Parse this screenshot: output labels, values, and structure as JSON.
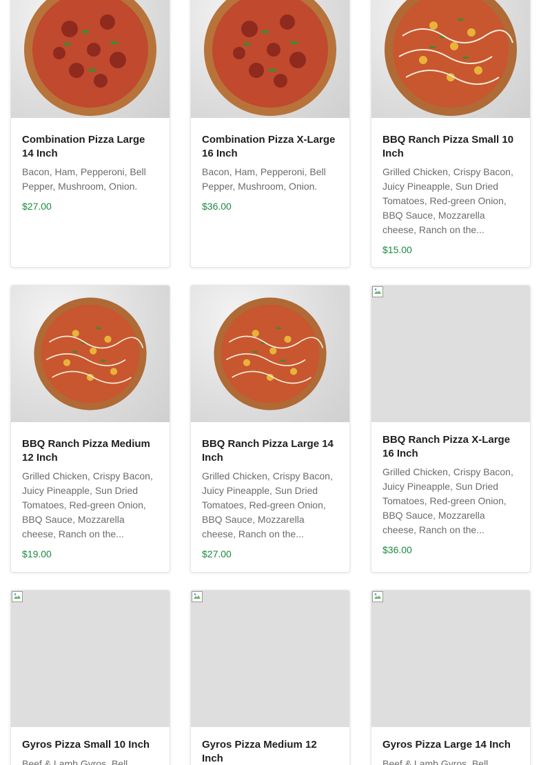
{
  "products": [
    {
      "title": "Combination Pizza Large 14 Inch",
      "description": "Bacon, Ham, Pepperoni, Bell Pepper, Mushroom, Onion.",
      "price": "$27.00",
      "image": "combination-pizza-photo"
    },
    {
      "title": "Combination Pizza X-Large 16 Inch",
      "description": "Bacon, Ham, Pepperoni, Bell Pepper, Mushroom, Onion.",
      "price": "$36.00",
      "image": "combination-pizza-photo"
    },
    {
      "title": "BBQ Ranch Pizza Small 10 Inch",
      "description": "Grilled Chicken, Crispy Bacon, Juicy Pineapple, Sun Dried Tomatoes, Red-green Onion, BBQ Sauce, Mozzarella cheese, Ranch on the...",
      "price": "$15.00",
      "image": "bbq-ranch-pizza-photo"
    },
    {
      "title": "BBQ Ranch Pizza Medium 12 Inch",
      "description": "Grilled Chicken, Crispy Bacon, Juicy Pineapple, Sun Dried Tomatoes, Red-green Onion, BBQ Sauce, Mozzarella cheese, Ranch on the...",
      "price": "$19.00",
      "image": "bbq-ranch-pizza-photo"
    },
    {
      "title": "BBQ Ranch Pizza Large 14 Inch",
      "description": "Grilled Chicken, Crispy Bacon, Juicy Pineapple, Sun Dried Tomatoes, Red-green Onion, BBQ Sauce, Mozzarella cheese, Ranch on the...",
      "price": "$27.00",
      "image": "bbq-ranch-pizza-photo"
    },
    {
      "title": "BBQ Ranch Pizza X-Large 16 Inch",
      "description": "Grilled Chicken, Crispy Bacon, Juicy Pineapple, Sun Dried Tomatoes, Red-green Onion, BBQ Sauce, Mozzarella cheese, Ranch on the...",
      "price": "$36.00",
      "image": "broken-image-icon"
    },
    {
      "title": "Gyros Pizza Small 10 Inch",
      "description": "Beef & Lamb Gyros, Bell",
      "price": "",
      "image": "broken-image-icon"
    },
    {
      "title": "Gyros Pizza Medium 12 Inch",
      "description": "",
      "price": "",
      "image": "broken-image-icon"
    },
    {
      "title": "Gyros Pizza Large 14 Inch",
      "description": "Beef & Lamb Gyros, Bell",
      "price": "",
      "image": "broken-image-icon"
    }
  ],
  "colors": {
    "price": "#1a8a3e",
    "title": "#1f1f1f",
    "description": "#6b6b6b"
  }
}
